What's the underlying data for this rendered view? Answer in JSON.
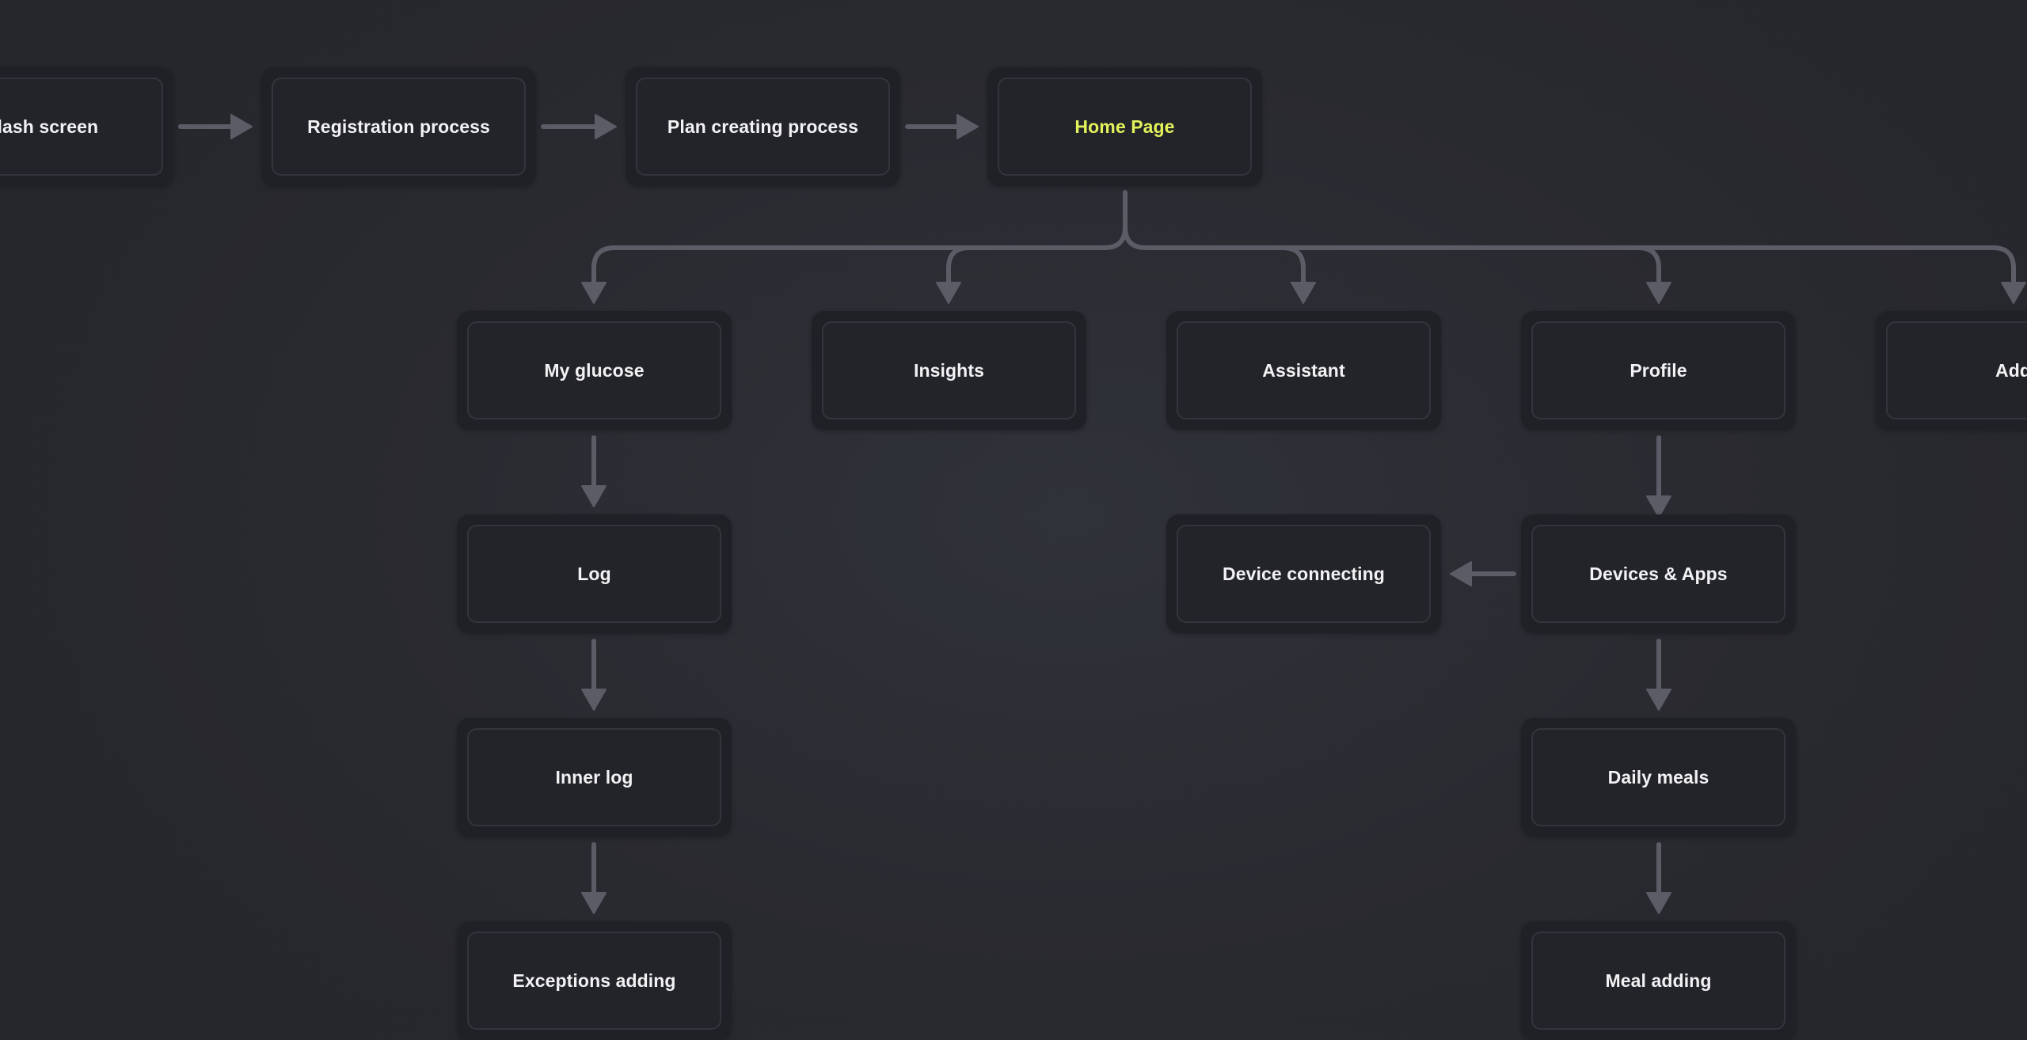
{
  "diagram": {
    "colors": {
      "background": "#2b2c32",
      "node_fill": "#232429",
      "node_border": "#34353c",
      "text": "#f2f2f4",
      "highlight_text": "#e3f25a",
      "connector": "#5b5c66"
    },
    "nodes": {
      "splash": "Splash screen",
      "registration": "Registration process",
      "plan": "Plan creating process",
      "home": "Home Page",
      "glucose": "My glucose",
      "insights": "Insights",
      "assistant": "Assistant",
      "profile": "Profile",
      "add": "Add",
      "log": "Log",
      "inner_log": "Inner log",
      "exceptions": "Exceptions adding",
      "device_connecting": "Device connecting",
      "devices_apps": "Devices & Apps",
      "daily_meals": "Daily meals",
      "meal_adding": "Meal adding"
    },
    "edges": [
      [
        "splash",
        "registration"
      ],
      [
        "registration",
        "plan"
      ],
      [
        "plan",
        "home"
      ],
      [
        "home",
        "glucose"
      ],
      [
        "home",
        "insights"
      ],
      [
        "home",
        "assistant"
      ],
      [
        "home",
        "profile"
      ],
      [
        "home",
        "add"
      ],
      [
        "glucose",
        "log"
      ],
      [
        "log",
        "inner_log"
      ],
      [
        "inner_log",
        "exceptions"
      ],
      [
        "profile",
        "devices_apps"
      ],
      [
        "devices_apps",
        "device_connecting"
      ],
      [
        "devices_apps",
        "daily_meals"
      ],
      [
        "daily_meals",
        "meal_adding"
      ]
    ]
  }
}
